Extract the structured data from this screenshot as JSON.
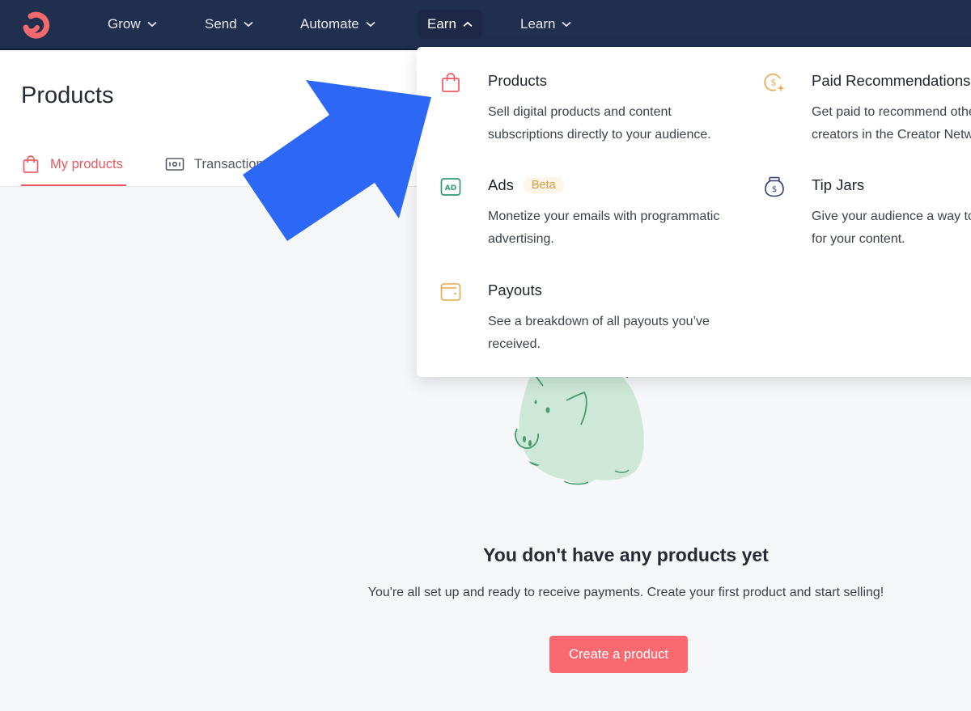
{
  "nav": {
    "logo": "convertkit-logo-icon",
    "items": [
      {
        "label": "Grow",
        "chevron": "chevron-down-icon"
      },
      {
        "label": "Send",
        "chevron": "chevron-down-icon"
      },
      {
        "label": "Automate",
        "chevron": "chevron-down-icon"
      },
      {
        "label": "Earn",
        "chevron": "chevron-up-icon",
        "active": true
      },
      {
        "label": "Learn",
        "chevron": "chevron-down-icon"
      }
    ]
  },
  "page": {
    "title": "Products",
    "tabs": [
      {
        "label": "My products",
        "icon": "shopping-bag-icon",
        "active": true
      },
      {
        "label": "Transactions",
        "icon": "banknote-icon"
      }
    ]
  },
  "earn_menu": {
    "items": [
      {
        "title": "Products",
        "icon": "shopping-bag-icon",
        "description": "Sell digital products and content subscriptions directly to your audience."
      },
      {
        "title": "Paid Recommendations",
        "icon": "dollar-sparkle-icon",
        "description": "Get paid to recommend other creators in the Creator Network."
      },
      {
        "title": "Ads",
        "badge": "Beta",
        "icon": "ad-icon",
        "description": "Monetize your emails with programmatic advertising."
      },
      {
        "title": "Tip Jars",
        "icon": "tip-jar-icon",
        "description": "Give your audience a way to tip for your content."
      },
      {
        "title": "Payouts",
        "icon": "wallet-icon",
        "description": "See a breakdown of all payouts you’ve received."
      }
    ]
  },
  "empty_state": {
    "illustration": "piggy-bank-illustration",
    "title": "You don't have any products yet",
    "subtitle": "You're all set up and ready to receive payments. Create your first product and start selling!",
    "button_label": "Create a product"
  },
  "colors": {
    "nav_bg": "#212f4f",
    "accent": "#fb6970",
    "annotation_arrow": "#2d67f5"
  }
}
